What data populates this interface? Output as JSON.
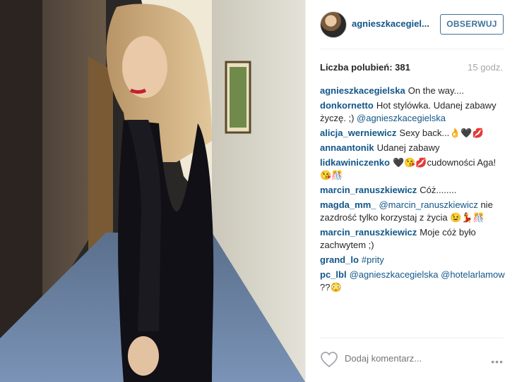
{
  "post": {
    "username": "agnieszkacegiel...",
    "follow_label": "OBSERWUJ",
    "likes_text": "Liczba polubień: 381",
    "time": "15 godz."
  },
  "comments": [
    {
      "author": "agnieszkacegielska",
      "text": "On the way...."
    },
    {
      "author": "donkornetto",
      "text": "Hot stylówka. Udanej zabawy życzę. ;) ",
      "mention": "@agnieszkacegielska"
    },
    {
      "author": "alicja_werniewicz",
      "text": "Sexy back...👌🖤💋"
    },
    {
      "author": "annaantonik",
      "text": "Udanej zabawy"
    },
    {
      "author": "lidkawiniczenko",
      "text": "🖤😘💋cudowności Aga!😘🎊"
    },
    {
      "author": "marcin_ranuszkiewicz",
      "text": "Cóż........"
    },
    {
      "author": "magda_mm_",
      "mention": "@marcin_ranuszkiewicz",
      "text": " nie zazdrość tylko korzystaj z życia 😉💃🎊"
    },
    {
      "author": "marcin_ranuszkiewicz",
      "text": "Moje cóż było zachwytem ;)"
    },
    {
      "author": "grand_lo",
      "mention": "#prity",
      "text": ""
    },
    {
      "author": "pc_lbl",
      "mention": "@agnieszkacegielska @hotelarlamow",
      "text": " ??😳"
    }
  ],
  "footer": {
    "comment_placeholder": "Dodaj komentarz...",
    "more_label": "•••"
  },
  "icons": {
    "like": "heart-icon",
    "more": "more-options-icon"
  },
  "colors": {
    "link": "#125688",
    "follow_border": "#3f729b",
    "muted": "#a5a7aa"
  }
}
